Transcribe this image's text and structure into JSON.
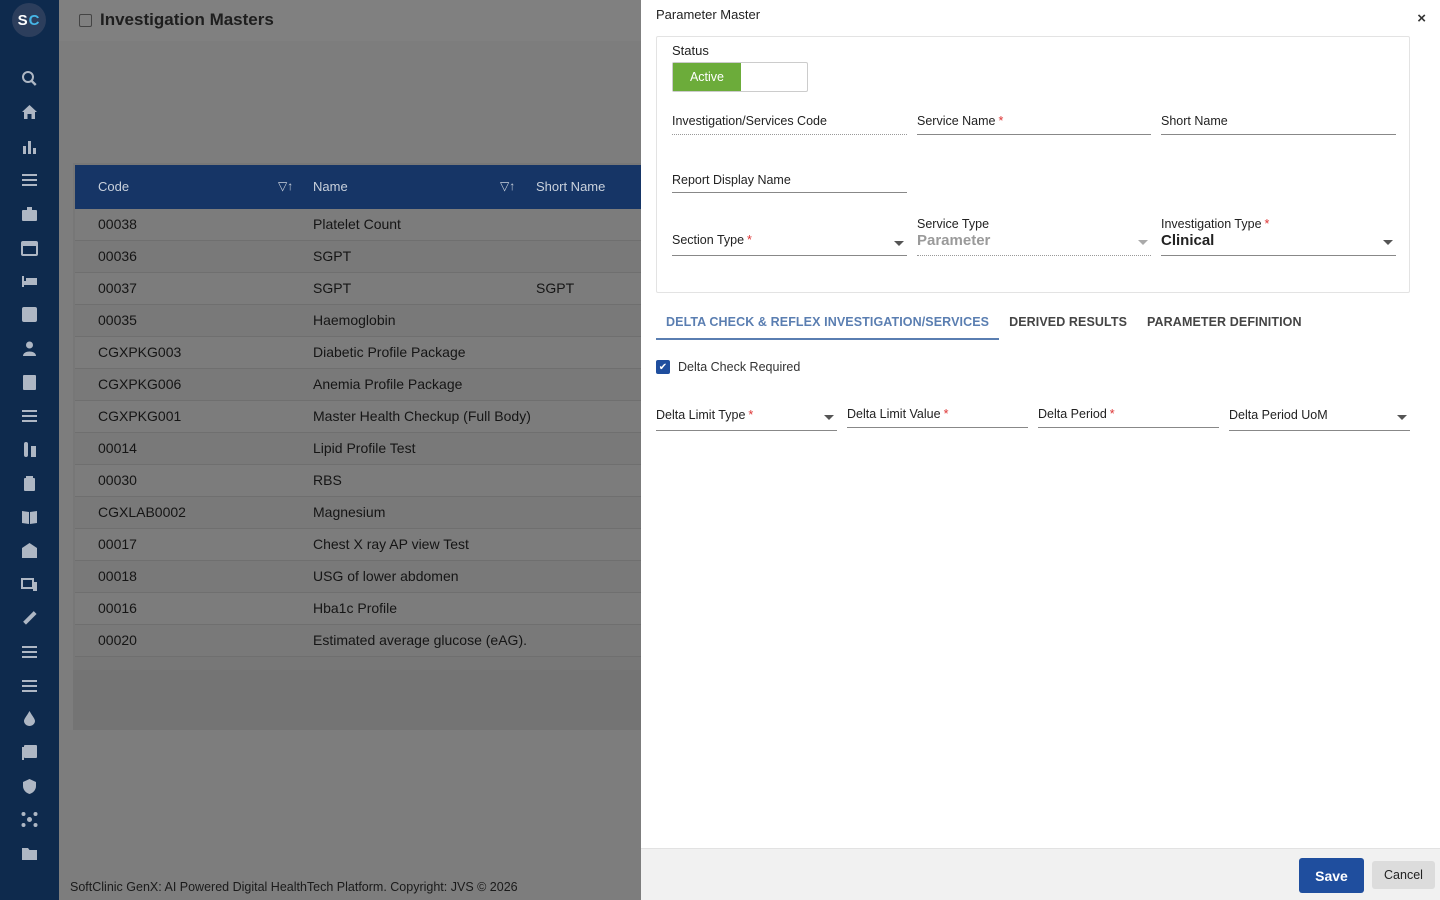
{
  "app": {
    "logo_s": "S",
    "logo_c": "C",
    "page_title": "Investigation Masters",
    "footer": "SoftClinic GenX: AI Powered Digital HealthTech Platform. Copyright: JVS © 2026"
  },
  "sidebar": {
    "icons": [
      "search-icon",
      "home-icon",
      "bar-chart-icon",
      "menu-icon",
      "briefcase-medical-icon",
      "calendar-icon",
      "bed-icon",
      "plus-square-icon",
      "user-icon",
      "document-icon",
      "list-icon",
      "lab-tube-icon",
      "medicine-icon",
      "book-icon",
      "hospital-icon",
      "devices-icon",
      "wrench-icon",
      "menu-icon",
      "menu-icon",
      "drop-icon",
      "add-file-icon",
      "shield-icon",
      "network-icon",
      "folder-icon"
    ]
  },
  "grid": {
    "columns": [
      "Code",
      "Name",
      "Short Name"
    ],
    "rows": [
      {
        "code": "00038",
        "name": "Platelet Count",
        "short": ""
      },
      {
        "code": "00036",
        "name": "SGPT",
        "short": ""
      },
      {
        "code": "00037",
        "name": "SGPT",
        "short": "SGPT"
      },
      {
        "code": "00035",
        "name": "Haemoglobin",
        "short": ""
      },
      {
        "code": "CGXPKG003",
        "name": "Diabetic Profile Package",
        "short": ""
      },
      {
        "code": "CGXPKG006",
        "name": "Anemia Profile Package",
        "short": ""
      },
      {
        "code": "CGXPKG001",
        "name": "Master Health Checkup (Full Body)",
        "short": ""
      },
      {
        "code": "00014",
        "name": "Lipid Profile Test",
        "short": ""
      },
      {
        "code": "00030",
        "name": "RBS",
        "short": ""
      },
      {
        "code": "CGXLAB0002",
        "name": "Magnesium",
        "short": ""
      },
      {
        "code": "00017",
        "name": "Chest X ray AP view Test",
        "short": ""
      },
      {
        "code": "00018",
        "name": "USG of lower abdomen",
        "short": ""
      },
      {
        "code": "00016",
        "name": "Hba1c Profile",
        "short": ""
      },
      {
        "code": "00020",
        "name": "Estimated average glucose (eAG).",
        "short": ""
      }
    ]
  },
  "modal": {
    "title": "Parameter Master",
    "close": "×",
    "status_label": "Status",
    "status_value": "Active",
    "fields": {
      "inv_code": "Investigation/Services Code",
      "service_name": "Service Name",
      "short_name": "Short Name",
      "report_display_name": "Report Display Name",
      "section_type": "Section Type",
      "service_type": "Service Type",
      "service_type_value": "Parameter",
      "investigation_type": "Investigation Type",
      "investigation_type_value": "Clinical"
    },
    "required_mark": "*",
    "tabs": [
      "DELTA CHECK & REFLEX INVESTIGATION/SERVICES",
      "DERIVED RESULTS",
      "PARAMETER DEFINITION"
    ],
    "delta_check_label": "Delta Check Required",
    "delta_check_checked": true,
    "delta_fields": {
      "limit_type": "Delta Limit Type",
      "limit_value": "Delta Limit Value",
      "period": "Delta Period",
      "period_uom": "Delta Period UoM"
    },
    "save": "Save",
    "cancel": "Cancel"
  },
  "colors": {
    "sidebar": "#0e2a4d",
    "grid_header": "#163566",
    "active_toggle": "#6cac3a",
    "primary": "#1f4e9e",
    "tab_active": "#5a7eb1"
  }
}
